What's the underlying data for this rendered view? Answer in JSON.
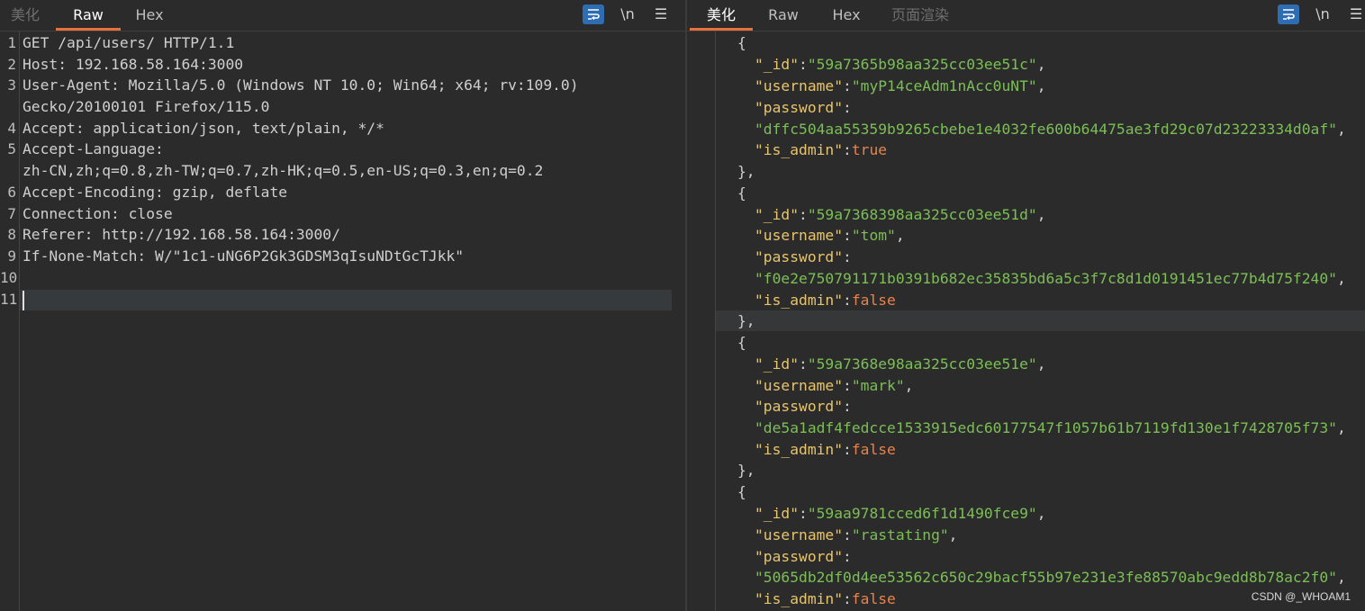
{
  "left_pane": {
    "tabs": [
      {
        "label": "美化"
      },
      {
        "label": "Raw"
      },
      {
        "label": "Hex"
      }
    ],
    "tools": {
      "newline_label": "\\n"
    },
    "line_numbers": [
      "1",
      "2",
      "3",
      "4",
      "5",
      "6",
      "7",
      "8",
      "9",
      "10",
      "11"
    ],
    "request_lines": [
      "GET /api/users/ HTTP/1.1",
      "Host: 192.168.58.164:3000",
      "User-Agent: Mozilla/5.0 (Windows NT 10.0; Win64; x64; rv:109.0)",
      "Gecko/20100101 Firefox/115.0",
      "Accept: application/json, text/plain, */*",
      "Accept-Language:",
      "zh-CN,zh;q=0.8,zh-TW;q=0.7,zh-HK;q=0.5,en-US;q=0.3,en;q=0.2",
      "Accept-Encoding: gzip, deflate",
      "Connection: close",
      "Referer: http://192.168.58.164:3000/",
      "If-None-Match: W/\"1c1-uNG6P2Gk3GDSM3qIsuNDtGcTJkk\""
    ]
  },
  "right_pane": {
    "tabs": [
      {
        "label": "美化"
      },
      {
        "label": "Raw"
      },
      {
        "label": "Hex"
      },
      {
        "label": "页面渲染"
      }
    ],
    "tools": {
      "newline_label": "\\n"
    },
    "keys": {
      "id": "\"_id\"",
      "username": "\"username\"",
      "password": "\"password\"",
      "is_admin": "\"is_admin\""
    },
    "users": [
      {
        "id": "\"59a7365b98aa325cc03ee51c\"",
        "username": "\"myP14ceAdm1nAcc0uNT\"",
        "password": "\"dffc504aa55359b9265cbebe1e4032fe600b64475ae3fd29c07d23223334d0af\"",
        "is_admin": "true"
      },
      {
        "id": "\"59a7368398aa325cc03ee51d\"",
        "username": "\"tom\"",
        "password": "\"f0e2e750791171b0391b682ec35835bd6a5c3f7c8d1d0191451ec77b4d75f240\"",
        "is_admin": "false"
      },
      {
        "id": "\"59a7368e98aa325cc03ee51e\"",
        "username": "\"mark\"",
        "password": "\"de5a1adf4fedcce1533915edc60177547f1057b61b7119fd130e1f7428705f73\"",
        "is_admin": "false"
      },
      {
        "id": "\"59aa9781cced6f1d1490fce9\"",
        "username": "\"rastating\"",
        "password": "\"5065db2df0d4ee53562c650c29bacf55b97e231e3fe88570abc9edd8b78ac2f0\"",
        "is_admin": "false"
      }
    ]
  },
  "watermark": "CSDN @_WHOAM1",
  "colors": {
    "background": "#2b2b2b",
    "accent_tab_underline": "#e8703a",
    "wrap_button": "#2f6db3",
    "json_key": "#e8c46b",
    "json_string": "#7bbf55",
    "json_keyword": "#e9834a"
  }
}
